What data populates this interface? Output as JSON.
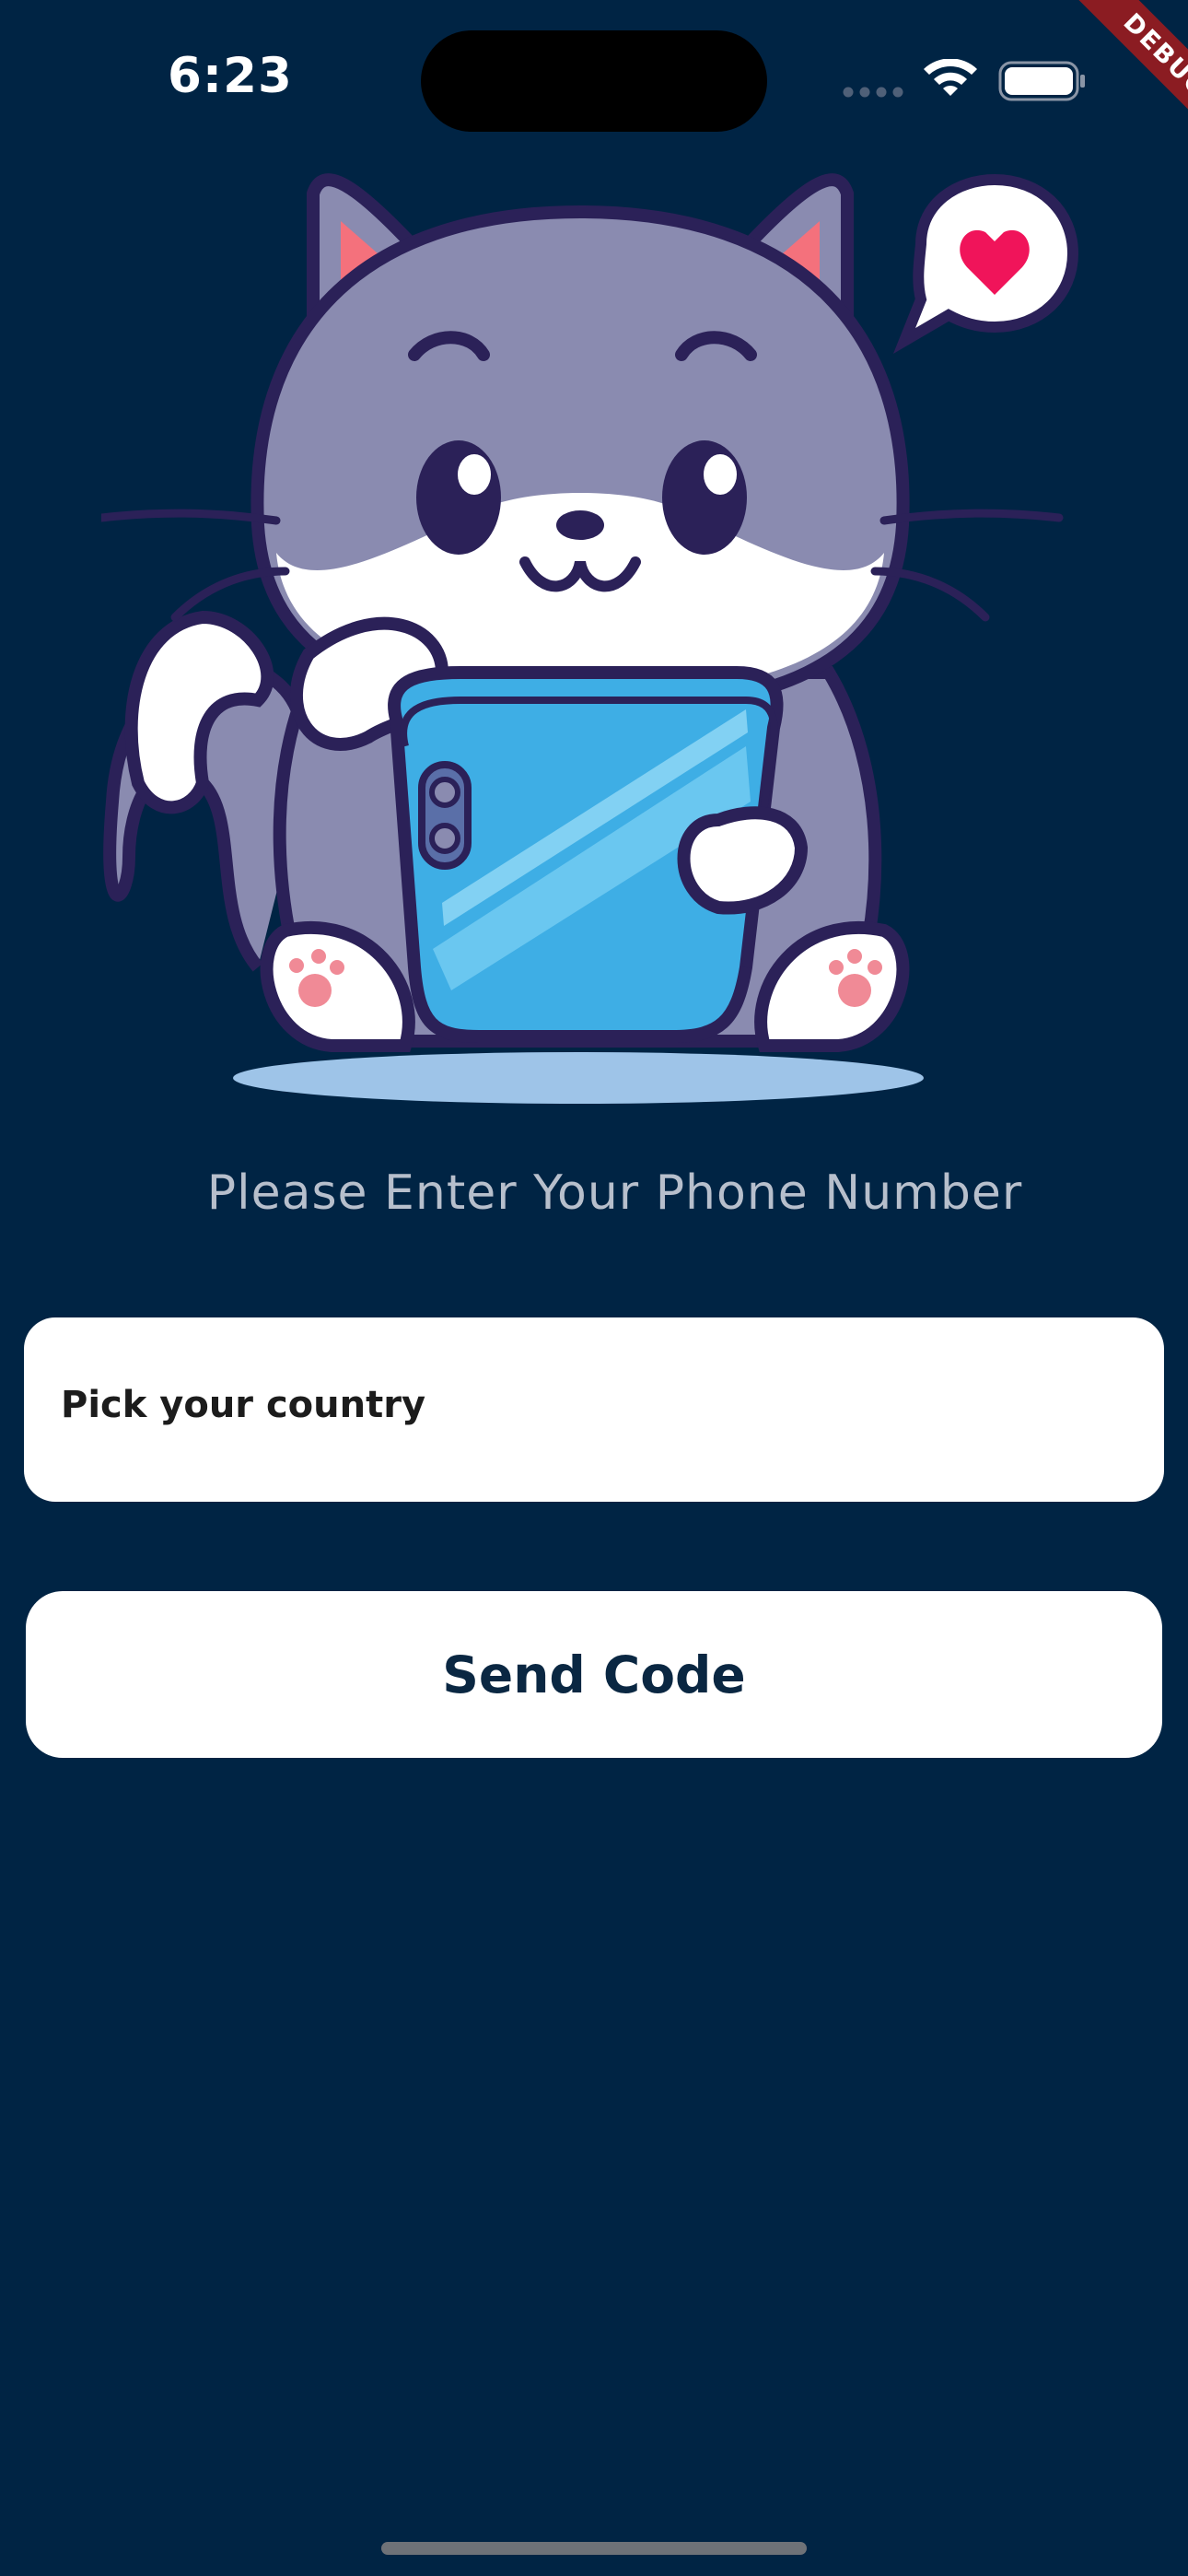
{
  "status_bar": {
    "time": "6:23",
    "icons": [
      "cellular-signal-icon",
      "wifi-icon",
      "battery-icon"
    ]
  },
  "debug_banner": "DEBUG",
  "illustration": {
    "icon": "cat-holding-phone-illustration",
    "bubble_icon": "heart-speech-bubble-icon"
  },
  "prompt": "Please Enter Your Phone Number",
  "country_picker": {
    "label": "Pick your country"
  },
  "send_button": {
    "label": "Send Code"
  },
  "colors": {
    "background": "#002444",
    "button_bg": "#ffffff",
    "button_text": "#0a2742",
    "accent_heart": "#f0145a",
    "phone_blue": "#3eaee5",
    "cat_gray": "#8a8bb0",
    "outline": "#2b2158"
  }
}
